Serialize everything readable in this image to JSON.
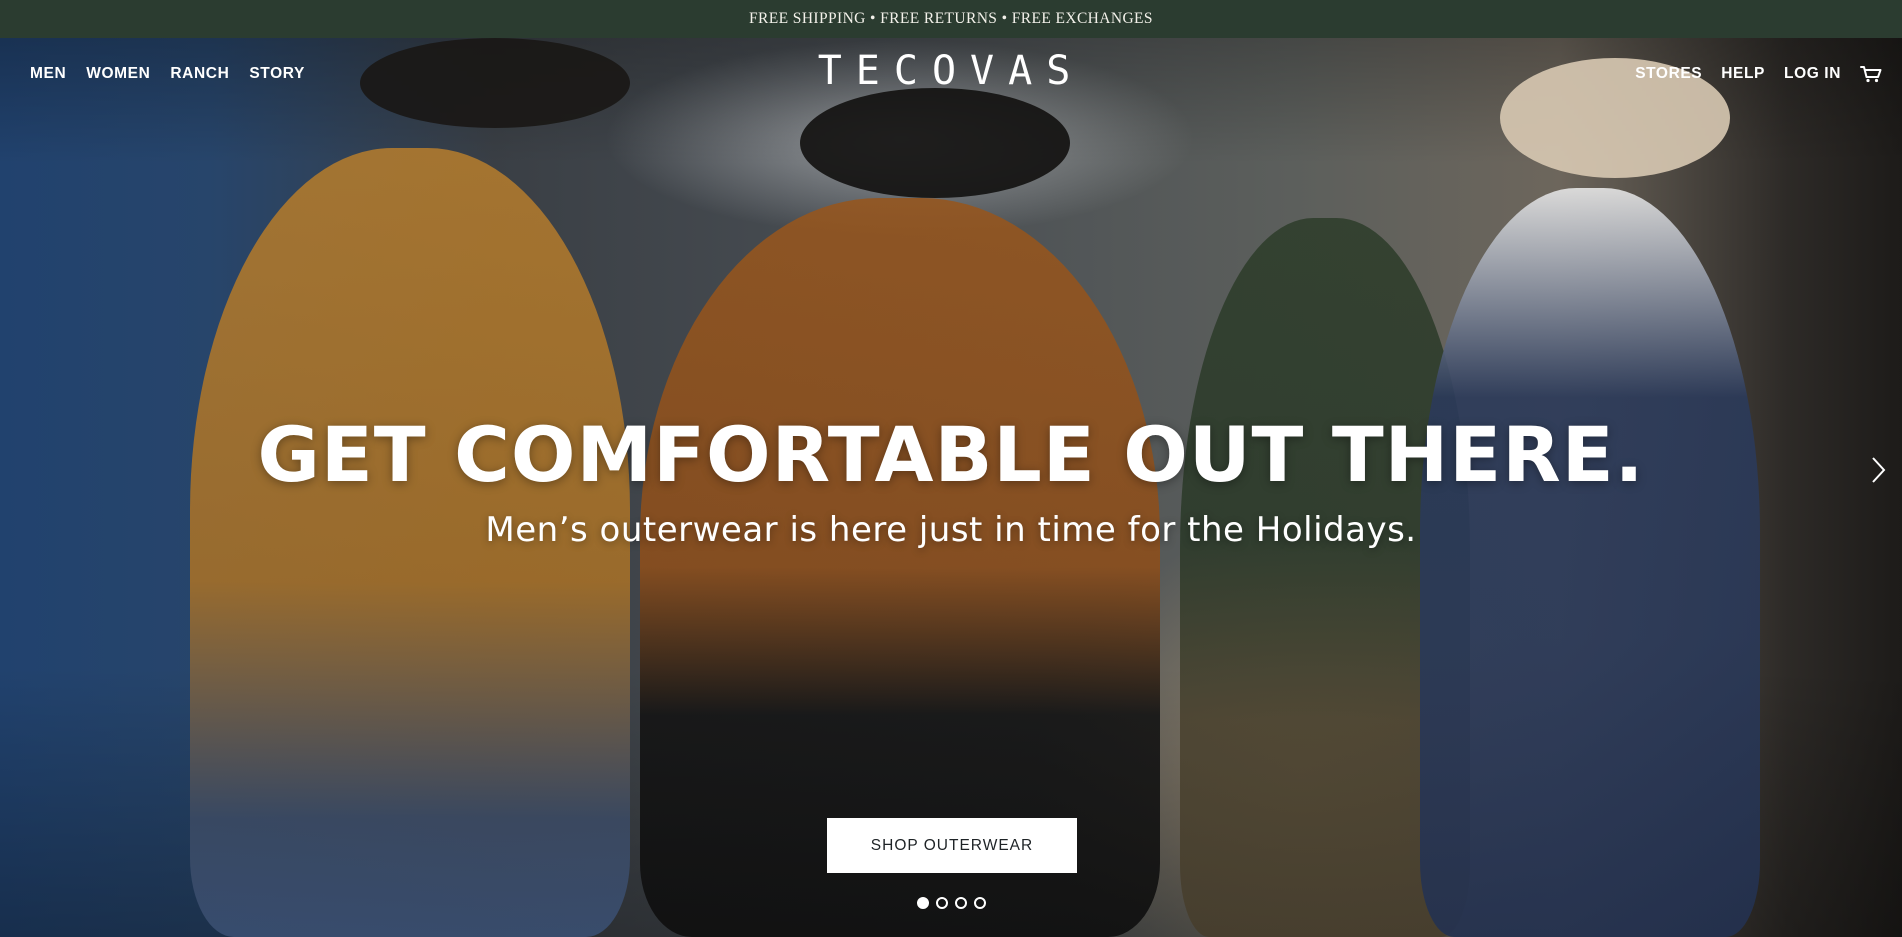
{
  "promo_bar": {
    "text": "FREE SHIPPING • FREE RETURNS • FREE EXCHANGES"
  },
  "nav": {
    "left": [
      "MEN",
      "WOMEN",
      "RANCH",
      "STORY"
    ],
    "right": [
      "STORES",
      "HELP",
      "LOG IN"
    ],
    "cart_icon": "cart-icon"
  },
  "logo": {
    "text": "TECOVAS"
  },
  "hero": {
    "headline": "GET COMFORTABLE OUT THERE.",
    "subhead": "Men’s outerwear is here just in time for the Holidays.",
    "cta_label": "SHOP OUTERWEAR",
    "next_icon": "chevron-right-icon",
    "slide_current": 1,
    "slide_total": 4
  },
  "colors": {
    "promo_bg": "#2b3c30",
    "text_light": "#ffffff",
    "cta_bg": "#ffffff",
    "cta_text": "#1e2326"
  }
}
